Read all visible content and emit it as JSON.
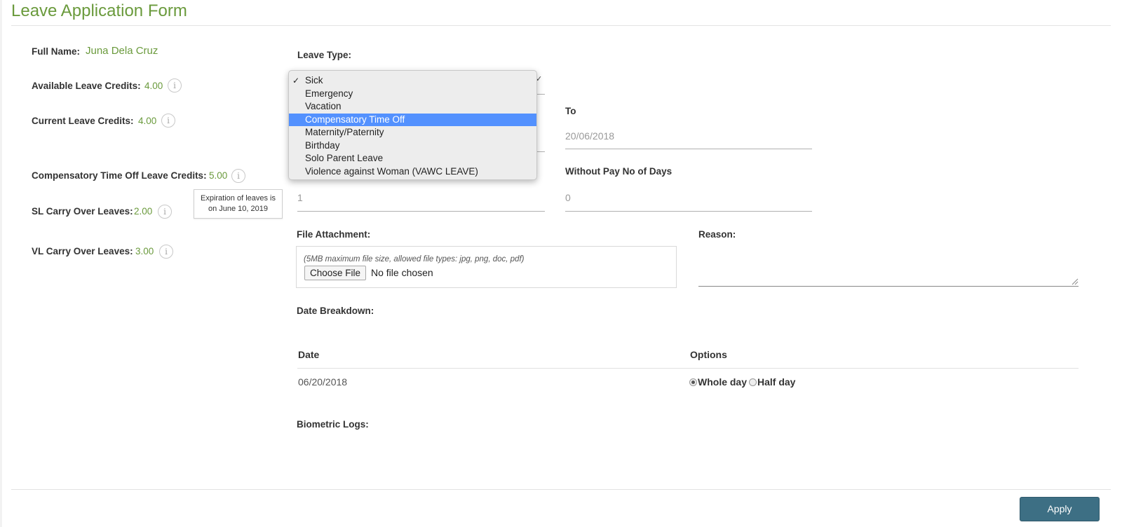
{
  "page": {
    "title": "Leave Application Form"
  },
  "sidebar": {
    "full_name_label": "Full Name:",
    "full_name_value": "Juna Dela Cruz",
    "available_credits_label": "Available Leave Credits:",
    "available_credits_value": "4.00",
    "current_credits_label": "Current Leave Credits:",
    "current_credits_value": "4.00",
    "cto_credits_label": "Compensatory Time Off Leave Credits:",
    "cto_credits_value": "5.00",
    "sl_carry_label": "SL Carry Over Leaves:",
    "sl_carry_value": "2.00",
    "vl_carry_label": "VL Carry Over Leaves:",
    "vl_carry_value": "3.00",
    "tooltip_line1": "Expiration of leaves is",
    "tooltip_line2": "on June 10, 2019",
    "info_glyph": "i"
  },
  "form": {
    "leave_type_label": "Leave Type:",
    "leave_type_options": [
      "Sick",
      "Emergency",
      "Vacation",
      "Compensatory Time Off",
      "Maternity/Paternity",
      "Birthday",
      "Solo Parent Leave",
      "Violence against Woman (VAWC LEAVE)"
    ],
    "checked_option": "Sick",
    "highlighted_option": "Compensatory Time Off",
    "to_label": "To",
    "to_value": "20/06/2018",
    "without_pay_label": "Without Pay No of Days",
    "with_pay_days_value": "1",
    "without_pay_value": "0",
    "file_attachment_label": "File Attachment:",
    "file_hint": "(5MB maximum file size, allowed file types: jpg, png, doc, pdf)",
    "choose_file_label": "Choose File",
    "no_file_text": "No file chosen",
    "reason_label": "Reason:",
    "date_breakdown_label": "Date Breakdown:",
    "table": {
      "headers": [
        "Date",
        "Options"
      ],
      "rows": [
        {
          "date": "06/20/2018",
          "whole_day_label": "Whole day",
          "half_day_label": "Half day",
          "selected": "Whole day"
        }
      ]
    },
    "biometric_logs_label": "Biometric Logs:",
    "apply_label": "Apply"
  },
  "colors": {
    "accent_green": "#6a9a3c",
    "apply_button": "#3d6f84",
    "highlight_blue": "#5391fe"
  }
}
